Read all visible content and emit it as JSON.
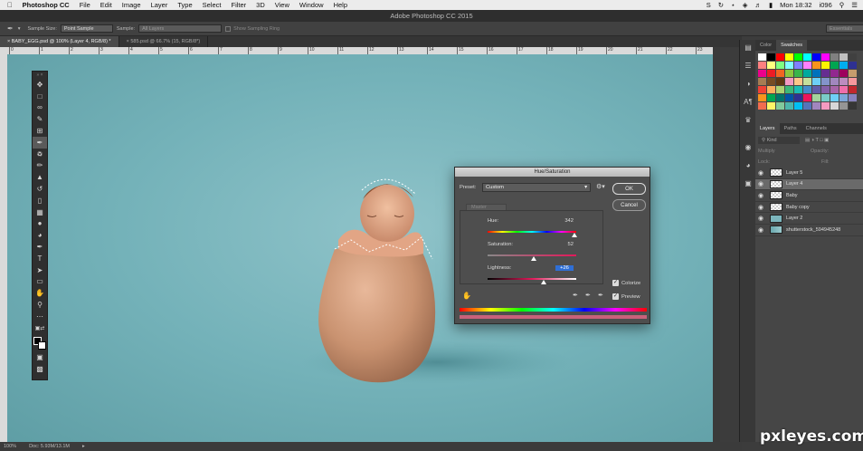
{
  "menubar": {
    "apple": "",
    "items": [
      "Photoshop CC",
      "File",
      "Edit",
      "Image",
      "Layer",
      "Type",
      "Select",
      "Filter",
      "3D",
      "View",
      "Window",
      "Help"
    ],
    "clock": "Mon 18:32",
    "user": "i096"
  },
  "window_title": "Adobe Photoshop CC 2015",
  "options": {
    "sample_size_label": "Sample Size:",
    "sample_size_value": "Point Sample",
    "sample_label": "Sample:",
    "sample_value": "All Layers",
    "show_ring": "Show Sampling Ring",
    "workspace": "Essentials"
  },
  "tabs": [
    {
      "label": "BABY_EGG.psd @ 100% (Layer 4, RGB/8) *"
    },
    {
      "label": "585.psd @ 66.7% (15, RGB/8*)"
    }
  ],
  "ruler_ticks": [
    "0",
    "1",
    "2",
    "3",
    "4",
    "5",
    "6",
    "7",
    "8",
    "9",
    "10",
    "11",
    "12",
    "13",
    "14",
    "15",
    "16",
    "17",
    "18",
    "19",
    "20",
    "21",
    "22",
    "23"
  ],
  "status": {
    "zoom": "100%",
    "doc": "Doc: 5.93M/13.1M"
  },
  "panels": {
    "color_tab": "Color",
    "swatches_tab": "Swatches",
    "layers_tab": "Layers",
    "paths_tab": "Paths",
    "channels_tab": "Channels",
    "kind_label": "Kind",
    "blend_mode": "Multiply",
    "opacity_label": "Opacity:",
    "lock_label": "Lock:",
    "fill_label": "Fill:"
  },
  "swatch_colors": [
    "#ffffff",
    "#000000",
    "#ff0000",
    "#ffff00",
    "#00ff00",
    "#00ffff",
    "#0000ff",
    "#ff00ff",
    "#808080",
    "#c0c0c0",
    "#404040",
    "#ff8080",
    "#ffff80",
    "#80ff80",
    "#80ffff",
    "#8080ff",
    "#ff80ff",
    "#f7941d",
    "#fff200",
    "#00a651",
    "#00aeef",
    "#2e3192",
    "#ec008c",
    "#ed1c24",
    "#f26522",
    "#8dc63f",
    "#39b54a",
    "#00a99d",
    "#0072bc",
    "#662d91",
    "#92278f",
    "#9e005d",
    "#c69c6d",
    "#a67c52",
    "#754c24",
    "#603913",
    "#f49ac2",
    "#fdc689",
    "#c4df9b",
    "#6dcff6",
    "#8393ca",
    "#a187be",
    "#bd8cbf",
    "#f6989d",
    "#ef4136",
    "#fbaf5d",
    "#acd373",
    "#3cb878",
    "#1cbbb4",
    "#448ccb",
    "#605ca8",
    "#855fa8",
    "#a864a8",
    "#f06eaa",
    "#c1272d",
    "#f7941d",
    "#00a651",
    "#00746b",
    "#0054a6",
    "#2e3192",
    "#ed145b",
    "#a3d39c",
    "#7accc8",
    "#6ecff6",
    "#7da7d9",
    "#8882be",
    "#f26c4f",
    "#fff568",
    "#82ca9c",
    "#4db6ac",
    "#00bff3",
    "#5574b9",
    "#a186be",
    "#f49ac1",
    "#d7d7d7",
    "#959595",
    "#363636"
  ],
  "layers": [
    {
      "name": "Layer 5",
      "selected": false
    },
    {
      "name": "Layer 4",
      "selected": true
    },
    {
      "name": "Baby",
      "selected": false
    },
    {
      "name": "Baby copy",
      "selected": false
    },
    {
      "name": "Layer 2",
      "selected": false
    },
    {
      "name": "shutterstock_594945248",
      "selected": false
    }
  ],
  "dialog": {
    "title": "Hue/Saturation",
    "preset_label": "Preset:",
    "preset_value": "Custom",
    "channel": "Master",
    "hue_label": "Hue:",
    "hue_value": "342",
    "saturation_label": "Saturation:",
    "saturation_value": "52",
    "lightness_label": "Lightness:",
    "lightness_value": "+26",
    "hue_fraction": 0.975,
    "saturation_fraction": 0.52,
    "lightness_fraction": 0.63,
    "ok": "OK",
    "cancel": "Cancel",
    "colorize": "Colorize",
    "preview": "Preview",
    "colorize_checked": true,
    "preview_checked": true
  },
  "watermark": "pxleyes.com"
}
